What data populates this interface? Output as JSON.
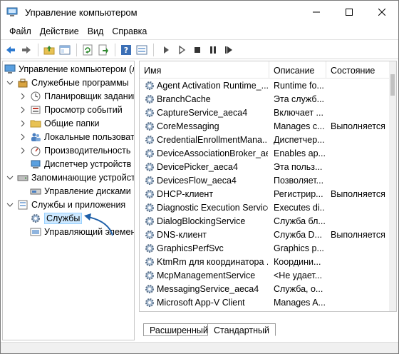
{
  "window": {
    "title": "Управление компьютером"
  },
  "menu": [
    "Файл",
    "Действие",
    "Вид",
    "Справка"
  ],
  "toolbar": {
    "buttons": [
      "back-icon",
      "forward-icon",
      "up-folder-icon",
      "show-tree-icon",
      "refresh-icon",
      "export-icon",
      "help-icon",
      "properties-icon",
      "play-icon",
      "play-alt-icon",
      "stop-icon",
      "pause-icon",
      "restart-icon"
    ]
  },
  "tree": {
    "root": "Управление компьютером (л",
    "items": [
      {
        "label": "Служебные программы"
      },
      {
        "label": "Планировщик заданий"
      },
      {
        "label": "Просмотр событий"
      },
      {
        "label": "Общие папки"
      },
      {
        "label": "Локальные пользовате"
      },
      {
        "label": "Производительность"
      },
      {
        "label": "Диспетчер устройств"
      },
      {
        "label": "Запоминающие устройст"
      },
      {
        "label": "Управление дисками"
      },
      {
        "label": "Службы и приложения"
      },
      {
        "label": "Службы"
      },
      {
        "label": "Управляющий элемен"
      }
    ]
  },
  "list": {
    "columns": [
      "Имя",
      "Описание",
      "Состояние"
    ],
    "rows": [
      {
        "name": "Agent Activation Runtime_...",
        "desc": "Runtime fo...",
        "state": ""
      },
      {
        "name": "BranchCache",
        "desc": "Эта служб...",
        "state": ""
      },
      {
        "name": "CaptureService_aeca4",
        "desc": "Включает ...",
        "state": ""
      },
      {
        "name": "CoreMessaging",
        "desc": "Manages c...",
        "state": "Выполняется"
      },
      {
        "name": "CredentialEnrollmentMana...",
        "desc": "Диспетчер...",
        "state": ""
      },
      {
        "name": "DeviceAssociationBroker_ae...",
        "desc": "Enables ap...",
        "state": ""
      },
      {
        "name": "DevicePicker_aeca4",
        "desc": "Эта польз...",
        "state": ""
      },
      {
        "name": "DevicesFlow_aeca4",
        "desc": "Позволяет...",
        "state": ""
      },
      {
        "name": "DHCP-клиент",
        "desc": "Регистрир...",
        "state": "Выполняется"
      },
      {
        "name": "Diagnostic Execution Service",
        "desc": "Executes di...",
        "state": ""
      },
      {
        "name": "DialogBlockingService",
        "desc": "Служба бл...",
        "state": ""
      },
      {
        "name": "DNS-клиент",
        "desc": "Служба D...",
        "state": "Выполняется"
      },
      {
        "name": "GraphicsPerfSvc",
        "desc": "Graphics p...",
        "state": ""
      },
      {
        "name": "KtmRm для координатора ...",
        "desc": "Координи...",
        "state": ""
      },
      {
        "name": "McpManagementService",
        "desc": "<Не удает...",
        "state": ""
      },
      {
        "name": "MessagingService_aeca4",
        "desc": "Служба, о...",
        "state": ""
      },
      {
        "name": "Microsoft App-V Client",
        "desc": "Manages A...",
        "state": ""
      }
    ]
  },
  "tabs": [
    "Расширенный",
    "Стандартный"
  ],
  "colors": {
    "selection": "#cce8ff",
    "arrow": "#1e5fa8",
    "accent": "#2b79d0"
  }
}
